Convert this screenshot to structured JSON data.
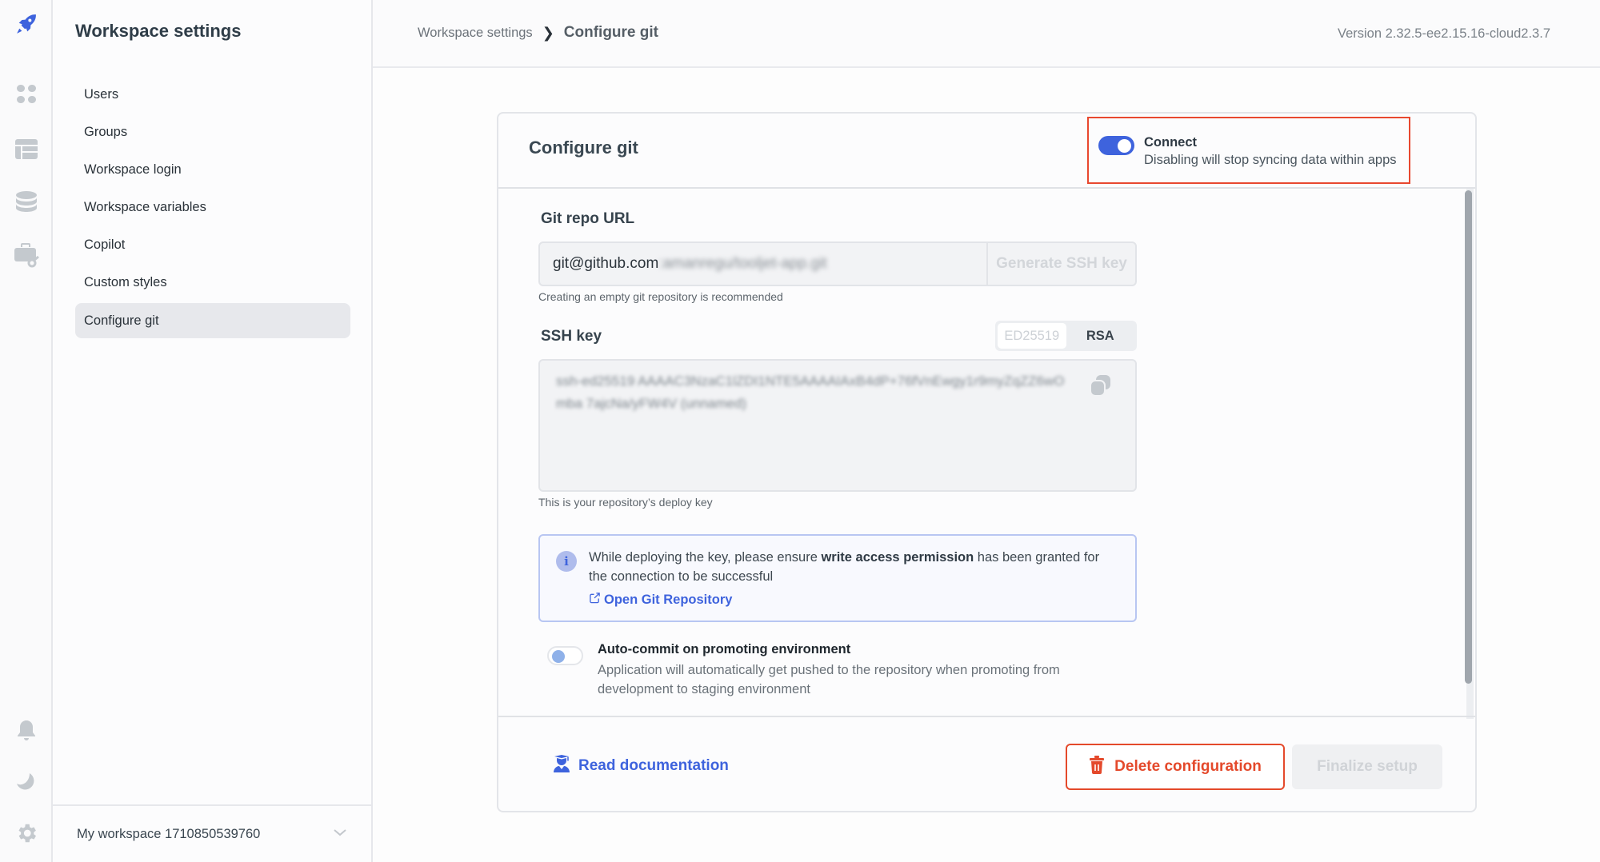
{
  "rail": {
    "icons": [
      "rocket-logo-icon",
      "apps-grid-icon",
      "database-table-icon",
      "data-sources-icon",
      "workspace-constants-icon",
      "notifications-bell-icon",
      "dark-mode-moon-icon",
      "settings-gear-icon"
    ],
    "brand_color": "#3e63dd",
    "icon_color": "#c4c9ce"
  },
  "sidebar": {
    "title": "Workspace settings",
    "items": [
      {
        "label": "Users",
        "active": false
      },
      {
        "label": "Groups",
        "active": false
      },
      {
        "label": "Workspace login",
        "active": false
      },
      {
        "label": "Workspace variables",
        "active": false
      },
      {
        "label": "Copilot",
        "active": false
      },
      {
        "label": "Custom styles",
        "active": false
      },
      {
        "label": "Configure git",
        "active": true
      }
    ],
    "workspace_selector": "My workspace 1710850539760"
  },
  "header": {
    "breadcrumb_root": "Workspace settings",
    "breadcrumb_separator": "❯",
    "breadcrumb_current": "Configure git",
    "version": "Version 2.32.5-ee2.15.16-cloud2.3.7"
  },
  "card": {
    "title": "Configure git",
    "connect": {
      "label": "Connect",
      "description": "Disabling will stop syncing data within apps",
      "enabled": true
    },
    "repo_url": {
      "label": "Git repo URL",
      "value_visible": "git@github.com",
      "value_blurred": ":amanregu/tooljet-app.git",
      "generate_button": "Generate SSH key",
      "hint": "Creating an empty git repository is recommended"
    },
    "ssh_key": {
      "label": "SSH key",
      "types": [
        {
          "label": "ED25519",
          "selected": true
        },
        {
          "label": "RSA",
          "selected": false
        }
      ],
      "value": "ssh-ed25519 AAAAC3NzaC1lZDI1NTE5AAAAIAxB4dP+76fVnEwgy1r9myZqZZ6wOmba 7ajcNa/yFW4V (unnamed)",
      "hint": "This is your repository’s deploy key"
    },
    "info": {
      "text_before": "While deploying the key, please ensure ",
      "text_bold": "write access permission",
      "text_after": " has been granted for the connection to be successful",
      "link": "Open Git Repository"
    },
    "auto_commit": {
      "title": "Auto-commit on promoting environment",
      "description": "Application will automatically get pushed to the repository when promoting from development to staging environment",
      "enabled": false
    },
    "footer": {
      "doc_link": "Read documentation",
      "delete_button": "Delete configuration",
      "finalize_button": "Finalize setup"
    }
  },
  "colors": {
    "accent": "#3e63dd",
    "danger": "#e4492b",
    "highlight_border": "#e8482f"
  }
}
